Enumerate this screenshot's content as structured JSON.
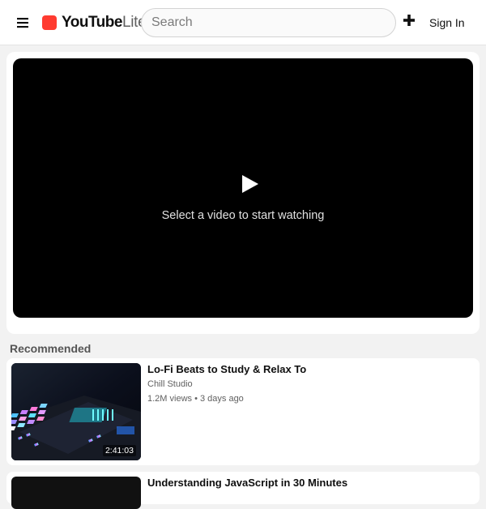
{
  "header": {
    "logo_main": "YouTube",
    "logo_sub": "Lite",
    "search_placeholder": "Search",
    "sign_in_label": "Sign In"
  },
  "player": {
    "message": "Select a video to start watching"
  },
  "recommended": {
    "heading": "Recommended",
    "videos": [
      {
        "title": "Lo-Fi Beats to Study & Relax To",
        "channel": "Chill Studio",
        "meta": "1.2M views • 3 days ago",
        "duration": "2:41:03"
      },
      {
        "title": "Understanding JavaScript in 30 Minutes"
      }
    ]
  },
  "icons": {
    "menu": "menu-icon",
    "add": "plus-icon",
    "play": "play-icon"
  },
  "colors": {
    "brand": "#ff3b30",
    "player_bg": "#000000",
    "page_bg": "#f2f2f2"
  }
}
